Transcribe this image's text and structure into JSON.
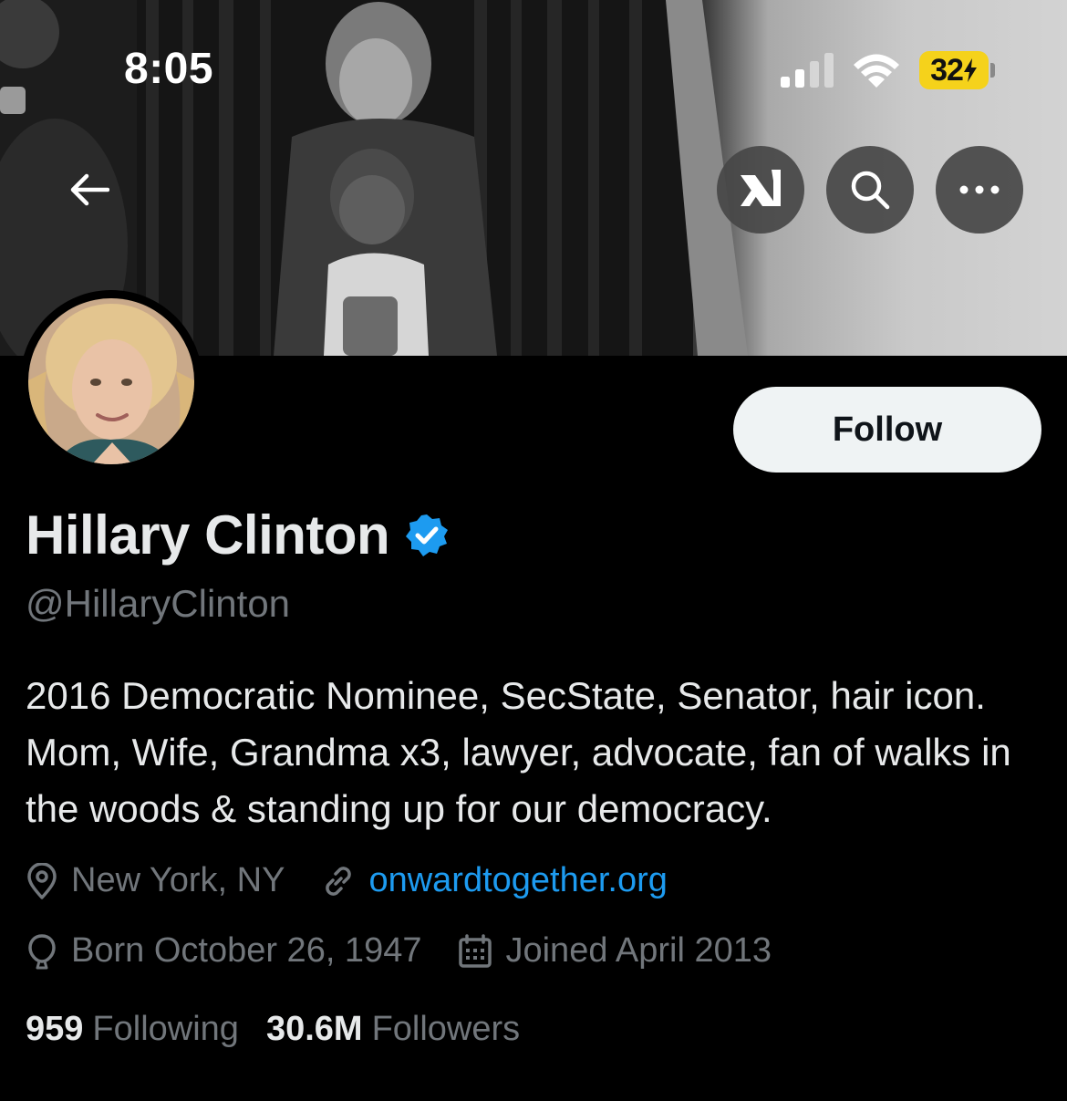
{
  "status_bar": {
    "time": "8:05",
    "battery": "32",
    "battery_charging": true,
    "battery_color": "#f5d21b"
  },
  "nav": {
    "back_icon": "arrow-left-icon",
    "grok_icon": "grok-icon",
    "search_icon": "search-icon",
    "more_icon": "more-horizontal-icon"
  },
  "profile": {
    "follow_label": "Follow",
    "display_name": "Hillary Clinton",
    "verified": true,
    "verified_color": "#1d9bf0",
    "handle": "@HillaryClinton",
    "bio": "2016 Democratic Nominee, SecState, Senator, hair icon. Mom, Wife, Grandma x3, lawyer, advocate, fan of walks in the woods & standing up for our democracy.",
    "location": "New York, NY",
    "website": "onwardtogether.org",
    "born": "Born October 26, 1947",
    "joined": "Joined April 2013",
    "following_count": "959",
    "following_label": "Following",
    "followers_count": "30.6M",
    "followers_label": "Followers"
  },
  "colors": {
    "background": "#000000",
    "link": "#1d9bf0",
    "muted_text": "#71767b",
    "primary_text": "#e7e9ea"
  }
}
